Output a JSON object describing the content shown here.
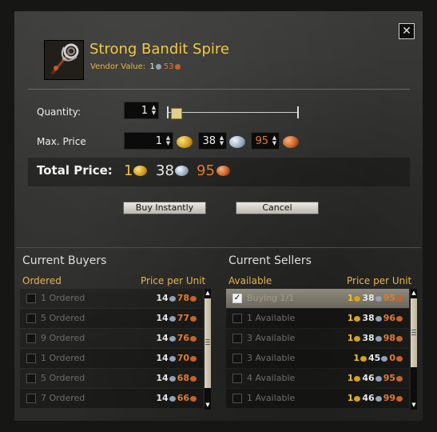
{
  "item": {
    "name": "Strong Bandit Spire",
    "vendor_label": "Vendor Value:",
    "vendor_gold": "1",
    "vendor_copper": "53",
    "icon": "staff-icon"
  },
  "close": {
    "label": "✕"
  },
  "quantity": {
    "label": "Quantity:",
    "value": "1",
    "slider_value": 1
  },
  "max_price": {
    "label": "Max. Price",
    "gold": "1",
    "silver": "38",
    "copper": "95"
  },
  "total": {
    "label": "Total Price:",
    "gold": "1",
    "silver": "38",
    "copper": "95"
  },
  "buttons": {
    "buy": "Buy Instantly",
    "cancel": "Cancel"
  },
  "buyers": {
    "title": "Current Buyers",
    "col_left": "Ordered",
    "col_right": "Price per Unit",
    "rows": [
      {
        "text": "1 Ordered",
        "silver": "14",
        "copper": "78"
      },
      {
        "text": "5 Ordered",
        "silver": "14",
        "copper": "77"
      },
      {
        "text": "9 Ordered",
        "silver": "14",
        "copper": "76"
      },
      {
        "text": "1 Ordered",
        "silver": "14",
        "copper": "70"
      },
      {
        "text": "5 Ordered",
        "silver": "14",
        "copper": "68"
      },
      {
        "text": "7 Ordered",
        "silver": "14",
        "copper": "66"
      }
    ]
  },
  "sellers": {
    "title": "Current Sellers",
    "col_left": "Available",
    "col_right": "Price per Unit",
    "rows": [
      {
        "text": "Buying 1/1",
        "gold": "1",
        "silver": "38",
        "copper": "95",
        "checked": true
      },
      {
        "text": "1 Available",
        "gold": "1",
        "silver": "38",
        "copper": "96"
      },
      {
        "text": "3 Available",
        "gold": "1",
        "silver": "38",
        "copper": "98"
      },
      {
        "text": "3 Available",
        "gold": "1",
        "silver": "45",
        "copper": "0"
      },
      {
        "text": "4 Available",
        "gold": "1",
        "silver": "46",
        "copper": "95"
      },
      {
        "text": "1 Available",
        "gold": "1",
        "silver": "46",
        "copper": "99"
      }
    ]
  },
  "colors": {
    "gold": "#f0c040",
    "silver": "#e8e8e8",
    "copper": "#e5792f",
    "title": "#f2c744",
    "header": "#e6b44b"
  }
}
